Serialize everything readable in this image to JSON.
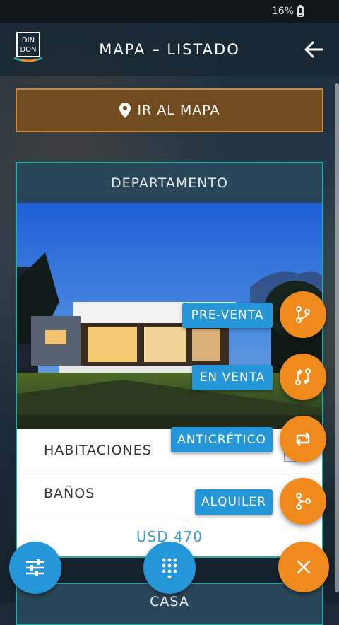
{
  "status_bar": {
    "battery": "16%"
  },
  "header": {
    "title": "MAPA – LISTADO"
  },
  "logo": {
    "line1": "DIN",
    "line2": "DON"
  },
  "map_button": {
    "label": "IR AL MAPA"
  },
  "card": {
    "type": "DEPARTAMENTO",
    "rows": [
      {
        "label": "HABITACIONES"
      },
      {
        "label": "BAÑOS"
      }
    ],
    "price": "USD 470"
  },
  "next_card": {
    "type": "CASA"
  },
  "fab_menu": [
    {
      "label": "PRE-VENTA",
      "icon": "branch-icon"
    },
    {
      "label": "EN VENTA",
      "icon": "swap-arrows-icon"
    },
    {
      "label": "ANTICRÉTICO",
      "icon": "sync-arrows-icon"
    },
    {
      "label": "ALQUILER",
      "icon": "merge-icon"
    }
  ],
  "colors": {
    "accent_orange": "#f08a1d",
    "accent_blue": "#2596d8",
    "teal_border": "#2aa9a2"
  }
}
